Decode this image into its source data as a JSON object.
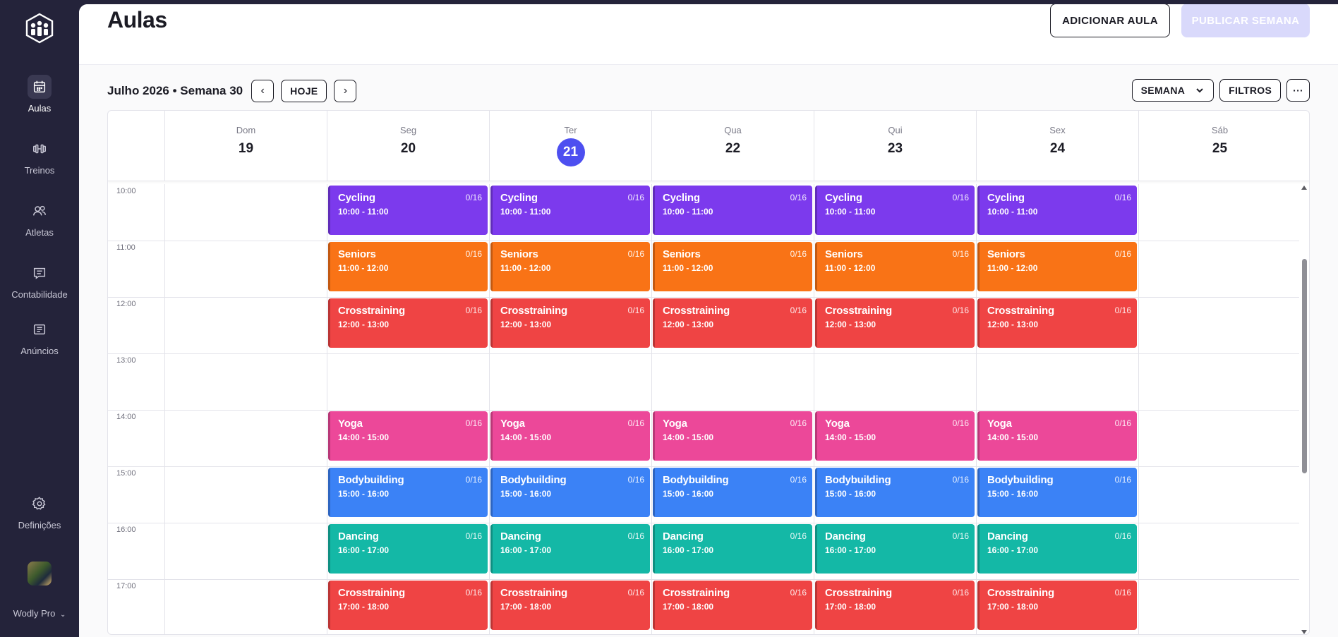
{
  "sidebar": {
    "logo_icon": "gym-logo-icon",
    "items": [
      {
        "label": "Aulas",
        "icon": "calendar-icon",
        "active": true
      },
      {
        "label": "Treinos",
        "icon": "dumbbell-icon",
        "active": false
      },
      {
        "label": "Atletas",
        "icon": "users-icon",
        "active": false
      },
      {
        "label": "Contabilidade",
        "icon": "receipt-icon",
        "active": false
      },
      {
        "label": "Anúncios",
        "icon": "newspaper-icon",
        "active": false
      }
    ],
    "settings": {
      "label": "Definições",
      "icon": "gear-icon"
    },
    "account": {
      "label": "Wodly Pro"
    }
  },
  "header": {
    "title": "Aulas",
    "add_label": "ADICIONAR AULA",
    "publish_label": "PUBLICAR SEMANA"
  },
  "toolbar": {
    "week_label": "Julho 2026 • Semana 30",
    "today_label": "HOJE",
    "view_label": "SEMANA",
    "filters_label": "FILTROS",
    "more_label": "···"
  },
  "calendar": {
    "days": [
      {
        "name": "Dom",
        "num": "19",
        "today": false
      },
      {
        "name": "Seg",
        "num": "20",
        "today": false
      },
      {
        "name": "Ter",
        "num": "21",
        "today": true
      },
      {
        "name": "Qua",
        "num": "22",
        "today": false
      },
      {
        "name": "Qui",
        "num": "23",
        "today": false
      },
      {
        "name": "Sex",
        "num": "24",
        "today": false
      },
      {
        "name": "Sáb",
        "num": "25",
        "today": false
      }
    ],
    "hours": [
      "10:00",
      "11:00",
      "12:00",
      "13:00",
      "14:00",
      "15:00",
      "16:00",
      "17:00"
    ],
    "classes": [
      {
        "name": "Cycling",
        "time": "10:00 - 11:00",
        "capacity": "0/16",
        "color": "#7c3aed",
        "slot": 0
      },
      {
        "name": "Seniors",
        "time": "11:00 - 12:00",
        "capacity": "0/16",
        "color": "#f97316",
        "slot": 1
      },
      {
        "name": "Crosstraining",
        "time": "12:00 - 13:00",
        "capacity": "0/16",
        "color": "#ef4444",
        "slot": 2
      },
      {
        "name": "Yoga",
        "time": "14:00 - 15:00",
        "capacity": "0/16",
        "color": "#ec4899",
        "slot": 4
      },
      {
        "name": "Bodybuilding",
        "time": "15:00 - 16:00",
        "capacity": "0/16",
        "color": "#3b82f6",
        "slot": 5
      },
      {
        "name": "Dancing",
        "time": "16:00 - 17:00",
        "capacity": "0/16",
        "color": "#14b8a6",
        "slot": 6
      },
      {
        "name": "Crosstraining",
        "time": "17:00 - 18:00",
        "capacity": "0/16",
        "color": "#ef4444",
        "slot": 7
      }
    ],
    "class_days": [
      1,
      2,
      3,
      4,
      5
    ]
  }
}
